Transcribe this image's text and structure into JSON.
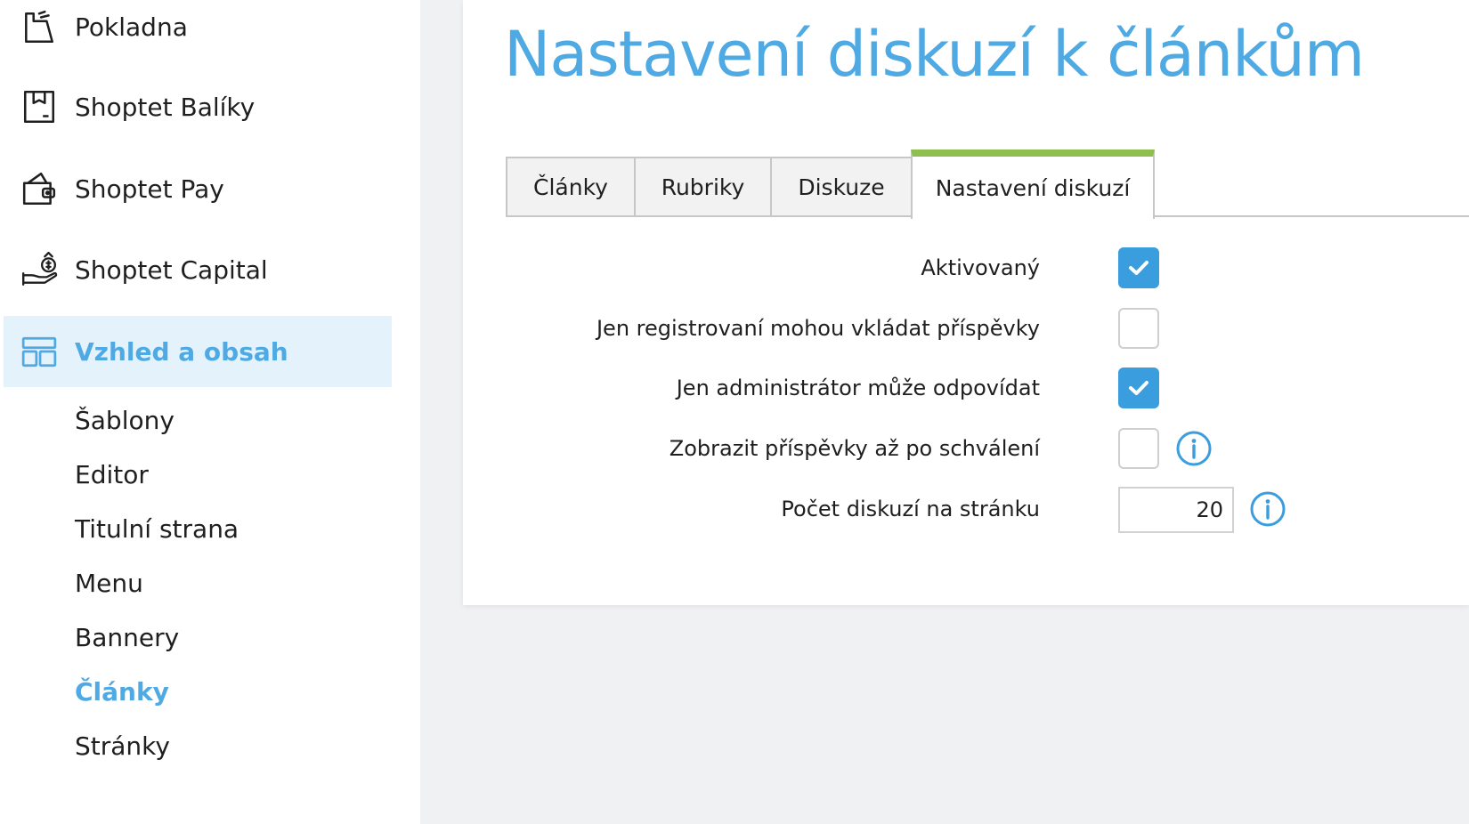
{
  "sidebar": {
    "items": [
      {
        "label": "Pokladna",
        "icon": "cash-register-icon"
      },
      {
        "label": "Shoptet Balíky",
        "icon": "package-icon"
      },
      {
        "label": "Shoptet Pay",
        "icon": "wallet-icon"
      },
      {
        "label": "Shoptet Capital",
        "icon": "money-hand-icon"
      },
      {
        "label": "Vzhled a obsah",
        "icon": "layout-icon",
        "active": true
      }
    ],
    "subitems": [
      {
        "label": "Šablony"
      },
      {
        "label": "Editor"
      },
      {
        "label": "Titulní strana"
      },
      {
        "label": "Menu"
      },
      {
        "label": "Bannery"
      },
      {
        "label": "Články",
        "active": true
      },
      {
        "label": "Stránky"
      }
    ]
  },
  "main": {
    "title": "Nastavení diskuzí k článkům",
    "tabs": [
      {
        "label": "Články"
      },
      {
        "label": "Rubriky"
      },
      {
        "label": "Diskuze"
      },
      {
        "label": "Nastavení diskuzí",
        "active": true
      }
    ],
    "settings": [
      {
        "label": "Aktivovaný",
        "checked": true
      },
      {
        "label": "Jen registrovaní mohou vkládat příspěvky",
        "checked": false
      },
      {
        "label": "Jen administrátor může odpovídat",
        "checked": true
      },
      {
        "label": "Zobrazit příspěvky až po schválení",
        "checked": false,
        "info": true
      },
      {
        "label": "Počet diskuzí na stránku",
        "value": "20",
        "info": true
      }
    ]
  },
  "colors": {
    "accent": "#4fa9e3",
    "checkbox_checked": "#3a9ede",
    "active_tab_border": "#8fc04f",
    "active_nav_bg": "#e4f2fc"
  }
}
